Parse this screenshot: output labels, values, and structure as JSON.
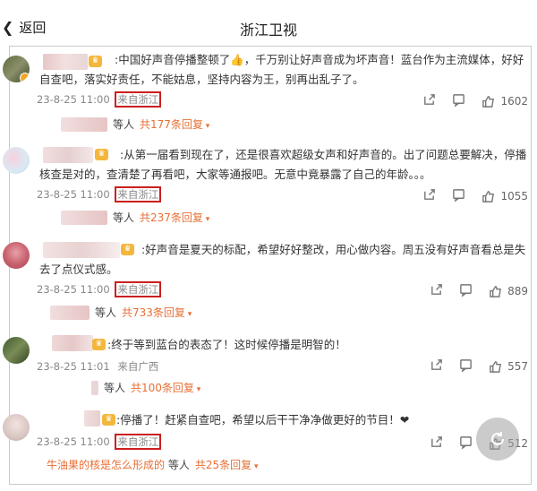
{
  "nav": {
    "back_label": "返回",
    "title": "浙江卫视"
  },
  "comments": [
    {
      "text": ":中国好声音停播整顿了👍，千万别让好声音成为坏声音！蓝台作为主流媒体，好好自查吧，落实好责任，不能姑息，坚持内容为王，别再出乱子了。",
      "time": "23-8-25 11:00",
      "location": "来自浙江",
      "likes": "1602",
      "reply_suffix": "等人",
      "reply_count": "共177条回复"
    },
    {
      "text": ":从第一届看到现在了，还是很喜欢超级女声和好声音的。出了问题总要解决，停播核查是对的，查清楚了再看吧，大家等通报吧。无意中竟暴露了自己的年龄。。。",
      "time": "23-8-25 11:00",
      "location": "来自浙江",
      "likes": "1055",
      "reply_suffix": "等人",
      "reply_count": "共237条回复"
    },
    {
      "text": ":好声音是夏天的标配，希望好好整改，用心做内容。周五没有好声音看总是失去了点仪式感。",
      "time": "23-8-25 11:00",
      "location": "来自浙江",
      "likes": "889",
      "reply_suffix": "等人",
      "reply_count": "共733条回复"
    },
    {
      "text": ":终于等到蓝台的表态了！这时候停播是明智的！",
      "time": "23-8-25 11:01",
      "location": "来自广西",
      "likes": "557",
      "reply_suffix": "等人",
      "reply_count": "共100条回复"
    },
    {
      "text": ":停播了！赶紧自查吧，希望以后干干净净做更好的节目！❤",
      "time": "23-8-25 11:00",
      "location": "来自浙江",
      "likes": "512",
      "reply_user": "牛油果的核是怎么形成的",
      "reply_suffix": "等人",
      "reply_count": "共25条回复"
    }
  ],
  "colors": {
    "highlight_box": "#cc1f1f",
    "reply_link": "#e76f35",
    "crown": "#f3b73d"
  },
  "icons": [
    "chevron-left-icon",
    "share-icon",
    "comment-icon",
    "like-icon",
    "refresh-icon"
  ]
}
